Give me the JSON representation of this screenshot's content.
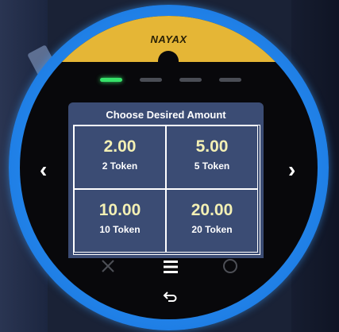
{
  "brand": {
    "name": "NAYAX"
  },
  "progress": {
    "current_step": 1,
    "total_steps": 4
  },
  "panel": {
    "title": "Choose Desired Amount",
    "options": [
      {
        "amount": "2.00",
        "tokens": "2 Token"
      },
      {
        "amount": "5.00",
        "tokens": "5 Token"
      },
      {
        "amount": "10.00",
        "tokens": "10 Token"
      },
      {
        "amount": "20.00",
        "tokens": "20 Token"
      }
    ]
  },
  "nav": {
    "prev": "‹",
    "next": "›"
  },
  "icons": {
    "cancel": "close-icon",
    "menu": "menu-icon",
    "confirm": "circle-icon",
    "back": "back-icon"
  },
  "colors": {
    "brand_band": "#e5b636",
    "ring": "#1f7fe6",
    "active_step": "#37e26a",
    "panel": "#3b4c74",
    "amount_text": "#f3f0b4"
  }
}
